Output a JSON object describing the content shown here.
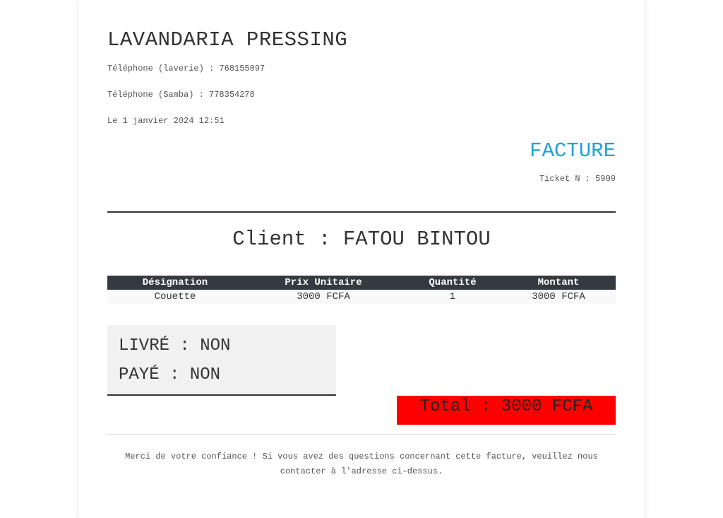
{
  "header": {
    "company_name": "LAVANDARIA PRESSING",
    "phone_laverie": "Téléphone (laverie) : 768155097",
    "phone_samba": "Téléphone (Samba) : 778354278",
    "date": "Le 1 janvier 2024 12:51"
  },
  "invoice": {
    "title": "FACTURE",
    "ticket": "Ticket N : 5909",
    "title_color": "#1ea1d9"
  },
  "client": {
    "line": "Client : FATOU BINTOU"
  },
  "table": {
    "columns": [
      "Désignation",
      "Prix Unitaire",
      "Quantité",
      "Montant"
    ],
    "rows": [
      [
        "Couette",
        "3000 FCFA",
        "1",
        "3000 FCFA"
      ]
    ]
  },
  "status": {
    "delivered": "LIVRÉ : NON",
    "paid": "PAYÉ : NON"
  },
  "total": {
    "text": "Total : 3000 FCFA",
    "background_color": "#ff0000"
  },
  "footer": {
    "message": "Merci de votre confiance ! Si vous avez des questions concernant cette facture, veuillez nous contacter à l'adresse ci-dessus."
  }
}
